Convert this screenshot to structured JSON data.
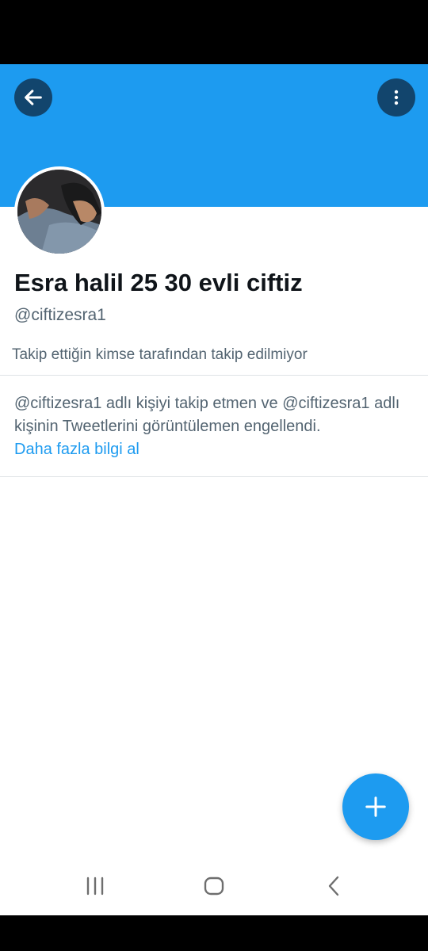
{
  "profile": {
    "display_name": "Esra halil 25 30 evli ciftiz",
    "handle": "@ciftizesra1",
    "follow_info": "Takip ettiğin kimse tarafından takip edilmiyor"
  },
  "blocked": {
    "message": "@ciftizesra1 adlı kişiyi takip etmen ve @ciftizesra1 adlı kişinin Tweetlerini görüntülemen engellendi.",
    "learn_more": "Daha fazla bilgi al"
  },
  "icons": {
    "back": "arrow-left-icon",
    "more": "more-vertical-icon",
    "fab": "plus-icon",
    "nav_recent": "recent-apps-icon",
    "nav_home": "home-icon",
    "nav_back": "chevron-left-icon"
  },
  "colors": {
    "accent": "#1d9bf0",
    "text_primary": "#0f1419",
    "text_secondary": "#536471"
  }
}
